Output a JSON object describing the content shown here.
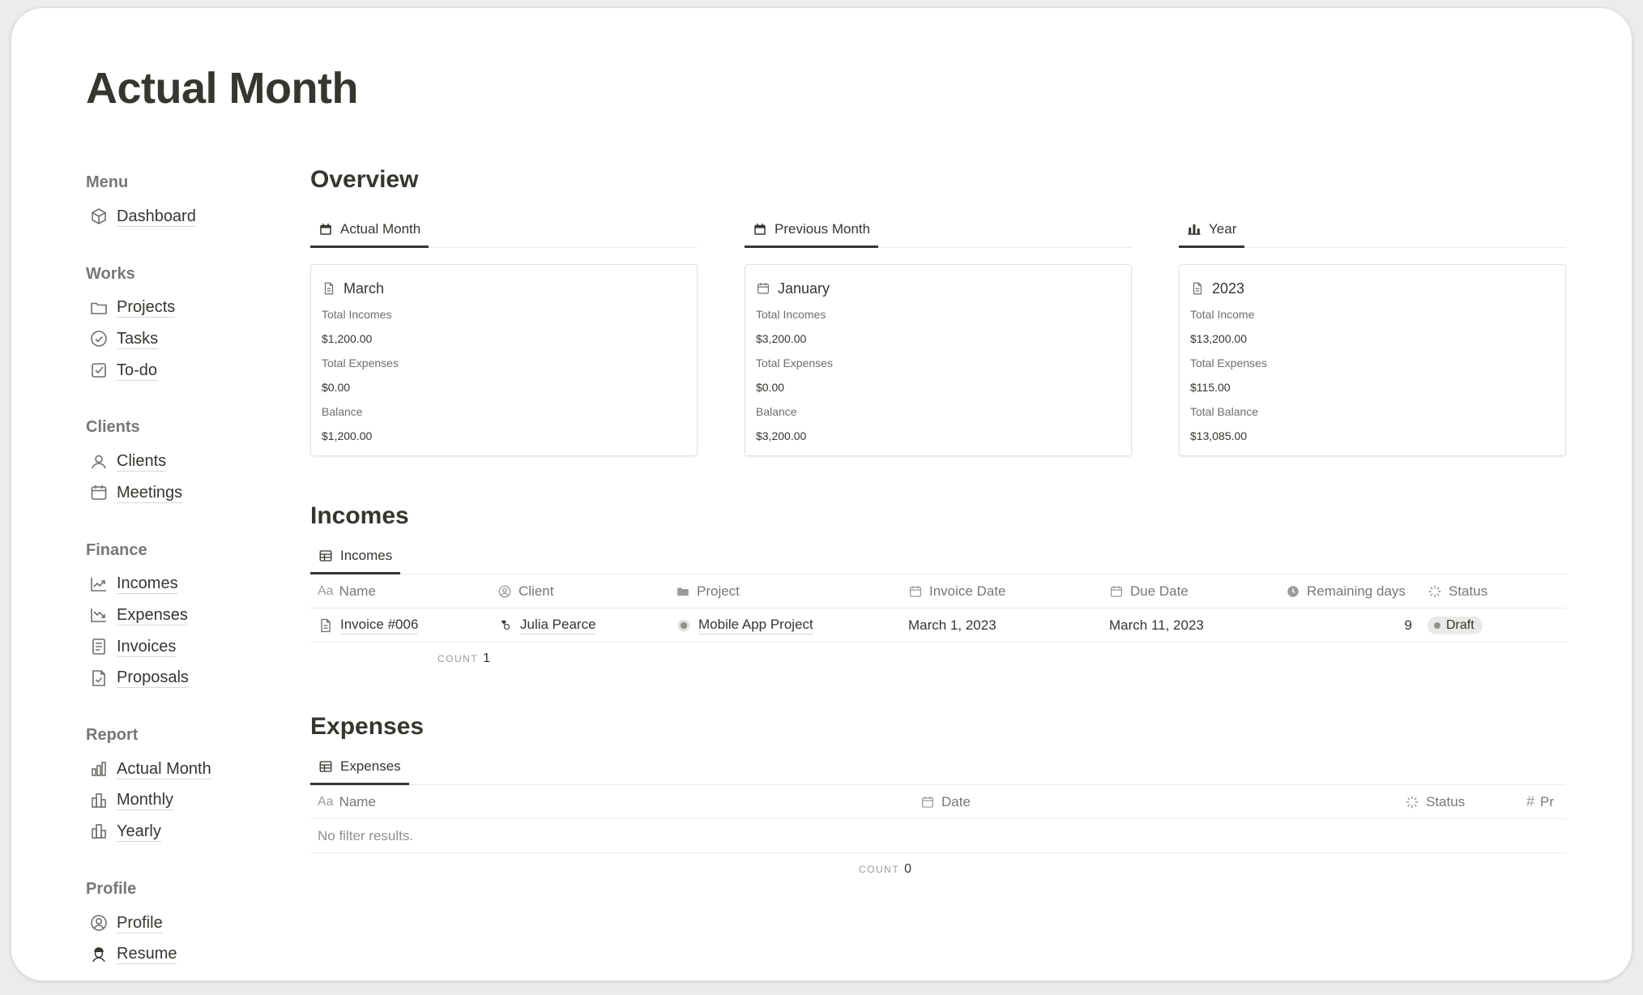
{
  "page": {
    "title": "Actual Month"
  },
  "sidebar": {
    "groups": [
      {
        "title": "Menu",
        "items": [
          {
            "label": "Dashboard",
            "icon": "cube-icon"
          }
        ]
      },
      {
        "title": "Works",
        "items": [
          {
            "label": "Projects",
            "icon": "folder-icon"
          },
          {
            "label": "Tasks",
            "icon": "check-circle-icon"
          },
          {
            "label": "To-do",
            "icon": "checkbox-icon"
          }
        ]
      },
      {
        "title": "Clients",
        "items": [
          {
            "label": "Clients",
            "icon": "person-icon"
          },
          {
            "label": "Meetings",
            "icon": "calendar-icon"
          }
        ]
      },
      {
        "title": "Finance",
        "items": [
          {
            "label": "Incomes",
            "icon": "trend-up-icon"
          },
          {
            "label": "Expenses",
            "icon": "trend-down-icon"
          },
          {
            "label": "Invoices",
            "icon": "receipt-icon"
          },
          {
            "label": "Proposals",
            "icon": "document-check-icon"
          }
        ]
      },
      {
        "title": "Report",
        "items": [
          {
            "label": "Actual Month",
            "icon": "bar-chart-icon"
          },
          {
            "label": "Monthly",
            "icon": "buildings-icon"
          },
          {
            "label": "Yearly",
            "icon": "buildings-icon"
          }
        ]
      },
      {
        "title": "Profile",
        "items": [
          {
            "label": "Profile",
            "icon": "user-circle-icon"
          },
          {
            "label": "Resume",
            "icon": "avatar-icon"
          }
        ]
      }
    ]
  },
  "overview": {
    "title": "Overview",
    "columns": [
      {
        "tab": "Actual Month",
        "tab_icon": "calendar-icon",
        "card": {
          "name": "March",
          "props": [
            {
              "label": "Total Incomes",
              "value": "$1,200.00"
            },
            {
              "label": "Total Expenses",
              "value": "$0.00"
            },
            {
              "label": "Balance",
              "value": "$1,200.00"
            }
          ]
        }
      },
      {
        "tab": "Previous Month",
        "tab_icon": "calendar-icon",
        "card": {
          "name": "January",
          "props": [
            {
              "label": "Total Incomes",
              "value": "$3,200.00"
            },
            {
              "label": "Total Expenses",
              "value": "$0.00"
            },
            {
              "label": "Balance",
              "value": "$3,200.00"
            }
          ]
        }
      },
      {
        "tab": "Year",
        "tab_icon": "bar-chart-icon",
        "card": {
          "name": "2023",
          "props": [
            {
              "label": "Total Income",
              "value": "$13,200.00"
            },
            {
              "label": "Total Expenses",
              "value": "$115.00"
            },
            {
              "label": "Total Balance",
              "value": "$13,085.00"
            }
          ]
        }
      }
    ]
  },
  "incomes": {
    "title": "Incomes",
    "tab": "Incomes",
    "columns": {
      "name": "Name",
      "client": "Client",
      "project": "Project",
      "invoice_date": "Invoice Date",
      "due_date": "Due Date",
      "remaining": "Remaining days",
      "status": "Status"
    },
    "name_prefix": "Aa",
    "rows": [
      {
        "name": "Invoice #006",
        "client": "Julia Pearce",
        "project": "Mobile App Project",
        "invoice_date": "March 1, 2023",
        "due_date": "March 11, 2023",
        "remaining": "9",
        "status": "Draft"
      }
    ],
    "count_label": "COUNT",
    "count": "1"
  },
  "expenses": {
    "title": "Expenses",
    "tab": "Expenses",
    "columns": {
      "name": "Name",
      "date": "Date",
      "status": "Status",
      "pr": "Pr"
    },
    "name_prefix": "Aa",
    "empty": "No filter results.",
    "count_label": "COUNT",
    "count": "0"
  }
}
